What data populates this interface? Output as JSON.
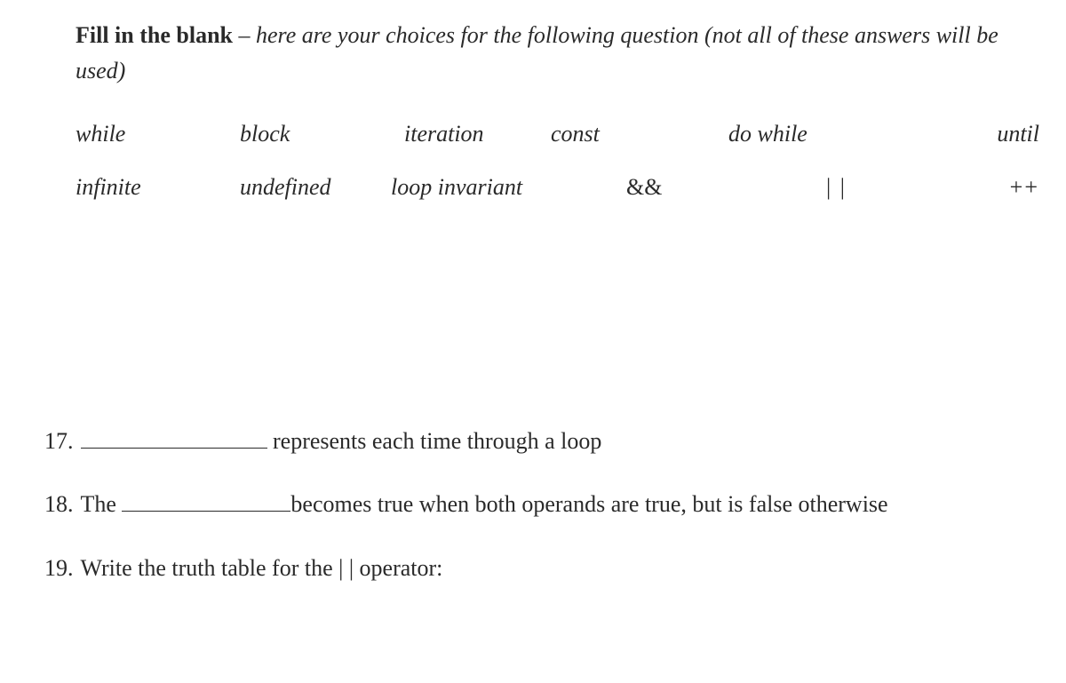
{
  "instructions": {
    "lead_bold": "Fill in the blank",
    "dash": " – ",
    "rest_italic": "here are your choices for the following question  (not all of these answers will be used)"
  },
  "choices": {
    "row1": [
      "while",
      "block",
      "iteration",
      "const",
      "do  while",
      "until"
    ],
    "row2": [
      "infinite",
      "undefined",
      "loop invariant",
      "&&",
      "| |",
      "++"
    ]
  },
  "questions": {
    "q17": {
      "num": "17.",
      "after_blank": " represents each time through a loop"
    },
    "q18": {
      "num": "18.",
      "before_blank": " The ",
      "after_blank": "becomes true when both operands are true, but is false otherwise"
    },
    "q19": {
      "num": "19.",
      "text": " Write the truth table for the | | operator:"
    }
  }
}
